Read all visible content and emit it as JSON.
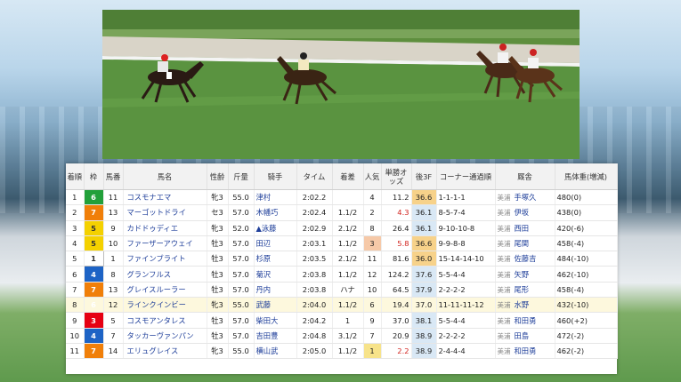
{
  "table": {
    "headers": {
      "rank": "着順",
      "frame": "枠",
      "number": "馬番",
      "horse": "馬名",
      "sexage": "性齢",
      "weight": "斤量",
      "jockey": "騎手",
      "time": "タイム",
      "margin": "着差",
      "pop": "人気",
      "odds": "単勝オッズ",
      "last3f": "後3F",
      "corner": "コーナー通過順",
      "trainer": "厩舎",
      "bodyweight": "馬体重(増減)"
    },
    "rows": [
      {
        "rank": "1",
        "frame": "6",
        "number": "11",
        "horse": "コスモナエマ",
        "sexage": "牝3",
        "weight": "55.0",
        "jockey": "津村",
        "time": "2:02.2",
        "margin": "",
        "pop": "4",
        "odds": "11.2",
        "last3f": "36.6",
        "corner": "1-1-1-1",
        "trainer_area": "美浦",
        "trainer": "手塚久",
        "bodyweight": "480(0)"
      },
      {
        "rank": "2",
        "frame": "7",
        "number": "13",
        "horse": "マーゴットドライ",
        "sexage": "セ3",
        "weight": "57.0",
        "jockey": "木幡巧",
        "time": "2:02.4",
        "margin": "1.1/2",
        "pop": "2",
        "odds": "4.3",
        "last3f": "36.1",
        "corner": "8-5-7-4",
        "trainer_area": "美浦",
        "trainer": "伊坂",
        "bodyweight": "438(0)"
      },
      {
        "rank": "3",
        "frame": "5",
        "number": "9",
        "horse": "カドドゥディエ",
        "sexage": "牝3",
        "weight": "52.0",
        "jockey": "▲泳藤",
        "time": "2:02.9",
        "margin": "2.1/2",
        "pop": "8",
        "odds": "26.4",
        "last3f": "36.1",
        "corner": "9-10-10-8",
        "trainer_area": "美浦",
        "trainer": "西田",
        "bodyweight": "420(-6)"
      },
      {
        "rank": "4",
        "frame": "5",
        "number": "10",
        "horse": "ファーザーアウェイ",
        "sexage": "牡3",
        "weight": "57.0",
        "jockey": "田辺",
        "time": "2:03.1",
        "margin": "1.1/2",
        "pop": "3",
        "odds": "5.8",
        "last3f": "36.6",
        "corner": "9-9-8-8",
        "trainer_area": "美浦",
        "trainer": "尾関",
        "bodyweight": "458(-4)"
      },
      {
        "rank": "5",
        "frame": "1",
        "number": "1",
        "horse": "ファインブライト",
        "sexage": "牡3",
        "weight": "57.0",
        "jockey": "杉原",
        "time": "2:03.5",
        "margin": "2.1/2",
        "pop": "11",
        "odds": "81.6",
        "last3f": "36.0",
        "corner": "15-14-14-10",
        "trainer_area": "美浦",
        "trainer": "佐藤吉",
        "bodyweight": "484(-10)"
      },
      {
        "rank": "6",
        "frame": "4",
        "number": "8",
        "horse": "グランフルス",
        "sexage": "牡3",
        "weight": "57.0",
        "jockey": "菊沢",
        "time": "2:03.8",
        "margin": "1.1/2",
        "pop": "12",
        "odds": "124.2",
        "last3f": "37.6",
        "corner": "5-5-4-4",
        "trainer_area": "美浦",
        "trainer": "矢野",
        "bodyweight": "462(-10)"
      },
      {
        "rank": "7",
        "frame": "7",
        "number": "13",
        "horse": "グレイスルーラー",
        "sexage": "牡3",
        "weight": "57.0",
        "jockey": "丹内",
        "time": "2:03.8",
        "margin": "ハナ",
        "pop": "10",
        "odds": "64.5",
        "last3f": "37.9",
        "corner": "2-2-2-2",
        "trainer_area": "美浦",
        "trainer": "尾形",
        "bodyweight": "458(-4)"
      },
      {
        "rank": "8",
        "frame": "6",
        "number": "12",
        "horse": "ラインクインビー",
        "sexage": "牝3",
        "weight": "55.0",
        "jockey": "武藤",
        "time": "2:04.0",
        "margin": "1.1/2",
        "pop": "6",
        "odds": "19.4",
        "last3f": "37.0",
        "corner": "11-11-11-12",
        "trainer_area": "美浦",
        "trainer": "水野",
        "bodyweight": "432(-10)"
      },
      {
        "rank": "9",
        "frame": "3",
        "number": "5",
        "horse": "コスモアンタレス",
        "sexage": "牡3",
        "weight": "57.0",
        "jockey": "柴田大",
        "time": "2:04.2",
        "margin": "1",
        "pop": "9",
        "odds": "37.0",
        "last3f": "38.1",
        "corner": "5-5-4-4",
        "trainer_area": "美浦",
        "trainer": "和田勇",
        "bodyweight": "460(+2)"
      },
      {
        "rank": "10",
        "frame": "4",
        "number": "7",
        "horse": "タッカーヴァンパン",
        "sexage": "牡3",
        "weight": "57.0",
        "jockey": "吉田豊",
        "time": "2:04.8",
        "margin": "3.1/2",
        "pop": "7",
        "odds": "20.9",
        "last3f": "38.9",
        "corner": "2-2-2-2",
        "trainer_area": "美浦",
        "trainer": "田島",
        "bodyweight": "472(-2)"
      },
      {
        "rank": "11",
        "frame": "7",
        "number": "14",
        "horse": "エリュグレイス",
        "sexage": "牝3",
        "weight": "55.0",
        "jockey": "横山武",
        "time": "2:05.0",
        "margin": "1.1/2",
        "pop": "1",
        "odds": "2.2",
        "last3f": "38.9",
        "corner": "2-4-4-4",
        "trainer_area": "美浦",
        "trainer": "和田勇",
        "bodyweight": "462(-2)"
      }
    ]
  },
  "video": {
    "caption": ""
  }
}
